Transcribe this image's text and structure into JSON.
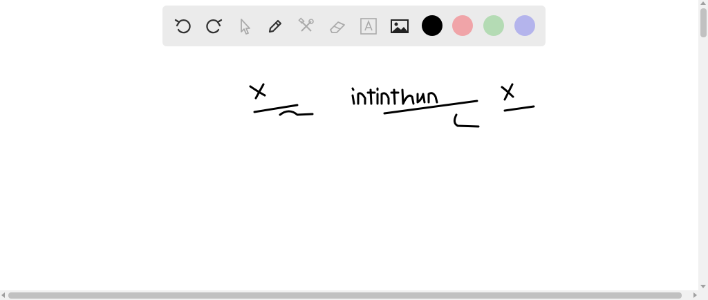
{
  "toolbar": {
    "tools": [
      {
        "name": "undo",
        "icon": "undo-icon",
        "enabled": true
      },
      {
        "name": "redo",
        "icon": "redo-icon",
        "enabled": true
      },
      {
        "name": "select",
        "icon": "pointer-icon",
        "enabled": false
      },
      {
        "name": "pen",
        "icon": "pen-icon",
        "enabled": true
      },
      {
        "name": "tools",
        "icon": "hammer-wrench-icon",
        "enabled": false
      },
      {
        "name": "eraser",
        "icon": "eraser-icon",
        "enabled": false
      },
      {
        "name": "text",
        "icon": "text-icon",
        "enabled": false
      },
      {
        "name": "image",
        "icon": "image-icon",
        "enabled": true
      }
    ],
    "colors": [
      "#000000",
      "#f0a4a8",
      "#b4dbb4",
      "#b4b4ec"
    ],
    "selected_color": "#000000"
  },
  "canvas": {
    "handwriting_texts": [
      "x",
      "x",
      "infinitum",
      "x"
    ],
    "ink_color": "#000000"
  }
}
